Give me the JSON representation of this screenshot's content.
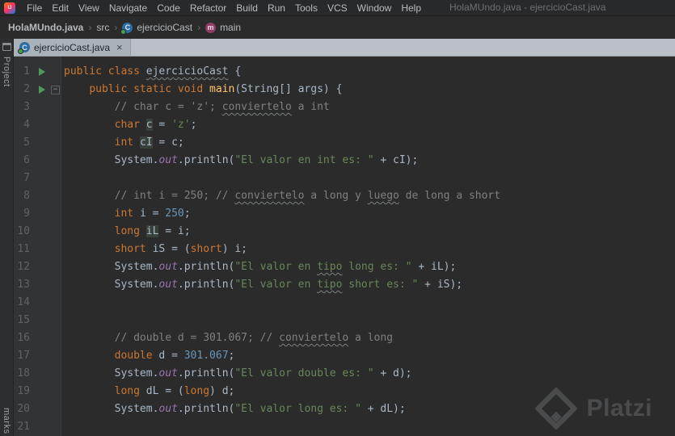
{
  "window": {
    "title": "HolaMUndo.java - ejercicioCast.java"
  },
  "menu": {
    "logo": "IJ",
    "items": [
      "File",
      "Edit",
      "View",
      "Navigate",
      "Code",
      "Refactor",
      "Build",
      "Run",
      "Tools",
      "VCS",
      "Window",
      "Help"
    ]
  },
  "breadcrumbs": {
    "sep": "›",
    "items": [
      {
        "label": "HolaMUndo.java",
        "bold": true
      },
      {
        "label": "src"
      },
      {
        "label": "ejercicioCast",
        "icon": "class"
      },
      {
        "label": "main",
        "icon": "method"
      }
    ]
  },
  "icons": {
    "class_letter": "C",
    "method_letter": "m"
  },
  "tool_windows": {
    "left_top": "Project",
    "left_bottom": "marks"
  },
  "tab": {
    "label": "ejercicioCast.java",
    "close": "×"
  },
  "editor": {
    "lines": [
      {
        "n": 1,
        "run": true,
        "tokens": [
          {
            "t": "public class ",
            "c": "k"
          },
          {
            "t": "ejercicioCast",
            "c": "p typo"
          },
          {
            "t": " {",
            "c": "p"
          }
        ]
      },
      {
        "n": 2,
        "run": true,
        "fold": true,
        "tokens": [
          {
            "t": "    ",
            "c": "p"
          },
          {
            "t": "public static void ",
            "c": "k"
          },
          {
            "t": "main",
            "c": "m"
          },
          {
            "t": "(String[] args) {",
            "c": "p"
          }
        ]
      },
      {
        "n": 3,
        "tokens": [
          {
            "t": "        ",
            "c": "p"
          },
          {
            "t": "// char c = 'z'; ",
            "c": "c"
          },
          {
            "t": "conviertelo",
            "c": "c typo"
          },
          {
            "t": " a int",
            "c": "c"
          }
        ]
      },
      {
        "n": 4,
        "tokens": [
          {
            "t": "        ",
            "c": "p"
          },
          {
            "t": "char ",
            "c": "k"
          },
          {
            "t": "c",
            "c": "p box"
          },
          {
            "t": " = ",
            "c": "p"
          },
          {
            "t": "'z'",
            "c": "s"
          },
          {
            "t": ";",
            "c": "p"
          }
        ]
      },
      {
        "n": 5,
        "tokens": [
          {
            "t": "        ",
            "c": "p"
          },
          {
            "t": "int ",
            "c": "k"
          },
          {
            "t": "cI",
            "c": "p box"
          },
          {
            "t": " = c;",
            "c": "p"
          }
        ]
      },
      {
        "n": 6,
        "tokens": [
          {
            "t": "        ",
            "c": "p"
          },
          {
            "t": "System.",
            "c": "p"
          },
          {
            "t": "out",
            "c": "f"
          },
          {
            "t": ".println(",
            "c": "p"
          },
          {
            "t": "\"El valor en int es: \"",
            "c": "s"
          },
          {
            "t": " + cI);",
            "c": "p"
          }
        ]
      },
      {
        "n": 7,
        "tokens": []
      },
      {
        "n": 8,
        "tokens": [
          {
            "t": "        ",
            "c": "p"
          },
          {
            "t": "// int i = 250; // ",
            "c": "c"
          },
          {
            "t": "conviertelo",
            "c": "c typo"
          },
          {
            "t": " a long y ",
            "c": "c"
          },
          {
            "t": "luego",
            "c": "c typo"
          },
          {
            "t": " de long a short",
            "c": "c"
          }
        ]
      },
      {
        "n": 9,
        "tokens": [
          {
            "t": "        ",
            "c": "p"
          },
          {
            "t": "int ",
            "c": "k"
          },
          {
            "t": "i = ",
            "c": "p"
          },
          {
            "t": "250",
            "c": "n"
          },
          {
            "t": ";",
            "c": "p"
          }
        ]
      },
      {
        "n": 10,
        "tokens": [
          {
            "t": "        ",
            "c": "p"
          },
          {
            "t": "long ",
            "c": "k"
          },
          {
            "t": "iL",
            "c": "p box"
          },
          {
            "t": " = i;",
            "c": "p"
          }
        ]
      },
      {
        "n": 11,
        "tokens": [
          {
            "t": "        ",
            "c": "p"
          },
          {
            "t": "short ",
            "c": "k"
          },
          {
            "t": "iS = (",
            "c": "p"
          },
          {
            "t": "short",
            "c": "k"
          },
          {
            "t": ") i;",
            "c": "p"
          }
        ]
      },
      {
        "n": 12,
        "tokens": [
          {
            "t": "        ",
            "c": "p"
          },
          {
            "t": "System.",
            "c": "p"
          },
          {
            "t": "out",
            "c": "f"
          },
          {
            "t": ".println(",
            "c": "p"
          },
          {
            "t": "\"El valor en ",
            "c": "s"
          },
          {
            "t": "tipo",
            "c": "s typo"
          },
          {
            "t": " long es: \"",
            "c": "s"
          },
          {
            "t": " + iL);",
            "c": "p"
          }
        ]
      },
      {
        "n": 13,
        "tokens": [
          {
            "t": "        ",
            "c": "p"
          },
          {
            "t": "System.",
            "c": "p"
          },
          {
            "t": "out",
            "c": "f"
          },
          {
            "t": ".println(",
            "c": "p"
          },
          {
            "t": "\"El valor en ",
            "c": "s"
          },
          {
            "t": "tipo",
            "c": "s typo"
          },
          {
            "t": " short es: \"",
            "c": "s"
          },
          {
            "t": " + iS);",
            "c": "p"
          }
        ]
      },
      {
        "n": 14,
        "tokens": []
      },
      {
        "n": 15,
        "tokens": []
      },
      {
        "n": 16,
        "tokens": [
          {
            "t": "        ",
            "c": "p"
          },
          {
            "t": "// double d = 301.067; // ",
            "c": "c"
          },
          {
            "t": "conviertelo",
            "c": "c typo"
          },
          {
            "t": " a long",
            "c": "c"
          }
        ]
      },
      {
        "n": 17,
        "tokens": [
          {
            "t": "        ",
            "c": "p"
          },
          {
            "t": "double ",
            "c": "k"
          },
          {
            "t": "d = ",
            "c": "p"
          },
          {
            "t": "301.067",
            "c": "n"
          },
          {
            "t": ";",
            "c": "p"
          }
        ]
      },
      {
        "n": 18,
        "tokens": [
          {
            "t": "        ",
            "c": "p"
          },
          {
            "t": "System.",
            "c": "p"
          },
          {
            "t": "out",
            "c": "f"
          },
          {
            "t": ".println(",
            "c": "p"
          },
          {
            "t": "\"El valor double es: \"",
            "c": "s"
          },
          {
            "t": " + d);",
            "c": "p"
          }
        ]
      },
      {
        "n": 19,
        "tokens": [
          {
            "t": "        ",
            "c": "p"
          },
          {
            "t": "long ",
            "c": "k"
          },
          {
            "t": "dL = (",
            "c": "p"
          },
          {
            "t": "long",
            "c": "k"
          },
          {
            "t": ") d;",
            "c": "p"
          }
        ]
      },
      {
        "n": 20,
        "tokens": [
          {
            "t": "        ",
            "c": "p"
          },
          {
            "t": "System.",
            "c": "p"
          },
          {
            "t": "out",
            "c": "f"
          },
          {
            "t": ".println(",
            "c": "p"
          },
          {
            "t": "\"El valor long es: \"",
            "c": "s"
          },
          {
            "t": " + dL);",
            "c": "p"
          }
        ]
      },
      {
        "n": 21,
        "tokens": []
      }
    ]
  },
  "watermark": {
    "text": "Platzi"
  },
  "colors": {
    "keyword": "#cc7832",
    "plain": "#a9b7c6",
    "string": "#6a8759",
    "number": "#6897bb",
    "comment": "#808080",
    "field": "#9876aa",
    "method_name": "#ffc66b",
    "editor_bg": "#2b2b2b",
    "gutter_bg": "#313335",
    "occurrence_highlight": "#38423a",
    "run_icon_green": "#4e9b57",
    "tab_strip": "#b9bfc5",
    "class_icon": "#2e6da3",
    "method_icon": "#8f3e63"
  }
}
